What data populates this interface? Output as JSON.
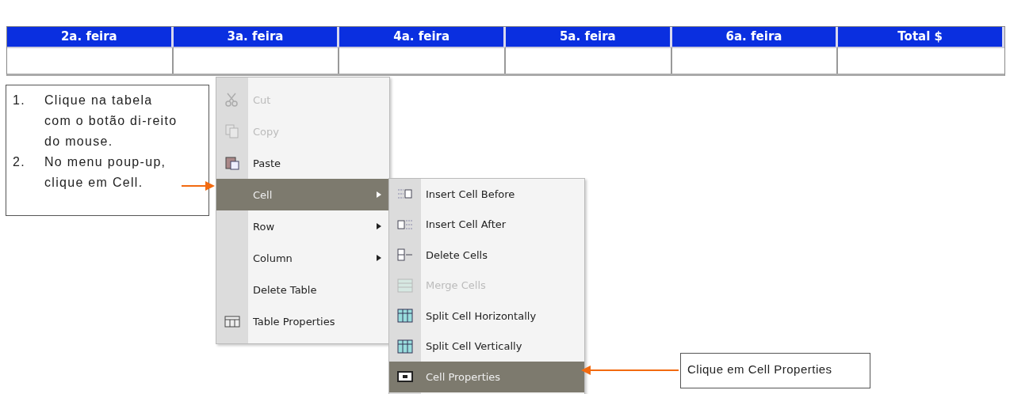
{
  "table": {
    "columns": [
      "2a. feira",
      "3a. feira",
      "4a. feira",
      "5a. feira",
      "6a. feira",
      "Total $"
    ]
  },
  "context_menu": {
    "items": [
      {
        "label": "Cut",
        "disabled": true,
        "selected": false,
        "submenu": false
      },
      {
        "label": "Copy",
        "disabled": true,
        "selected": false,
        "submenu": false
      },
      {
        "label": "Paste",
        "disabled": false,
        "selected": false,
        "submenu": false
      },
      {
        "label": "Cell",
        "disabled": false,
        "selected": true,
        "submenu": true
      },
      {
        "label": "Row",
        "disabled": false,
        "selected": false,
        "submenu": true
      },
      {
        "label": "Column",
        "disabled": false,
        "selected": false,
        "submenu": true
      },
      {
        "label": "Delete Table",
        "disabled": false,
        "selected": false,
        "submenu": false
      },
      {
        "label": "Table Properties",
        "disabled": false,
        "selected": false,
        "submenu": false
      }
    ]
  },
  "submenu": {
    "items": [
      {
        "label": "Insert Cell Before",
        "disabled": false,
        "selected": false
      },
      {
        "label": "Insert Cell After",
        "disabled": false,
        "selected": false
      },
      {
        "label": "Delete Cells",
        "disabled": false,
        "selected": false
      },
      {
        "label": "Merge Cells",
        "disabled": true,
        "selected": false
      },
      {
        "label": "Split Cell Horizontally",
        "disabled": false,
        "selected": false
      },
      {
        "label": "Split Cell Vertically",
        "disabled": false,
        "selected": false
      },
      {
        "label": "Cell Properties",
        "disabled": false,
        "selected": true
      }
    ]
  },
  "callouts": [
    {
      "steps": [
        {
          "number": "1.",
          "text": "Clique na tabela com o botão di-reito do mouse."
        },
        {
          "number": "2.",
          "text": "No menu poup-up, clique em Cell."
        }
      ]
    },
    {
      "text": "Clique em Cell Properties"
    }
  ]
}
